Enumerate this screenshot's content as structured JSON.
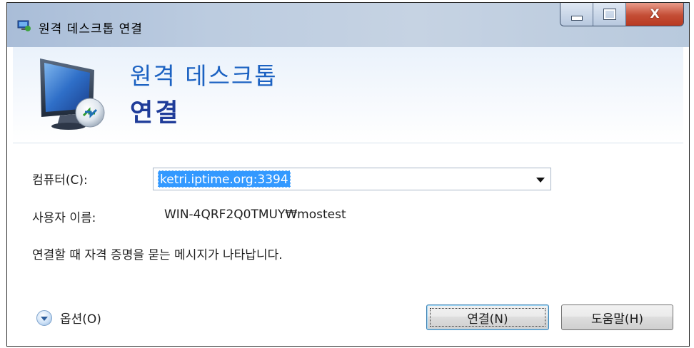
{
  "window": {
    "title": "원격 데스크톱 연결",
    "controls": [
      "minimize",
      "maximize",
      "close"
    ],
    "close_glyph": "X"
  },
  "header": {
    "line1": "원격 데스크톱",
    "line2": "연결"
  },
  "form": {
    "computer_label": "컴퓨터(C):",
    "computer_value": "ketri.iptime.org:3394",
    "user_label": "사용자 이름:",
    "user_value": "WIN-4QRF2Q0TMUY₩mostest",
    "note": "연결할 때 자격 증명을 묻는 메시지가 나타납니다."
  },
  "footer": {
    "options_label": "옵션(O)",
    "connect_label": "연결(N)",
    "help_label": "도움말(H)"
  },
  "colors": {
    "header_line1": "#1c62c2",
    "header_line2": "#1f3c99",
    "selection": "#3399ff",
    "close_button": "#c44d35"
  },
  "icons": {
    "app": "remote-desktop-icon",
    "monitor": "monitor-connection-icon",
    "options": "chevron-down-circle-icon",
    "dropdown": "dropdown-arrow-icon"
  }
}
